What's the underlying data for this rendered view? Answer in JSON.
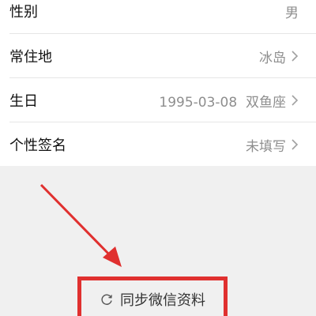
{
  "profile": {
    "rows": [
      {
        "label": "性别",
        "value": "男",
        "has_chevron": false
      },
      {
        "label": "常住地",
        "value": "冰岛",
        "has_chevron": true
      },
      {
        "label": "生日",
        "value": "1995-03-08  双鱼座",
        "has_chevron": true
      },
      {
        "label": "个性签名",
        "value": "未填写",
        "has_chevron": true
      }
    ]
  },
  "sync": {
    "label": "同步微信资料"
  },
  "colors": {
    "annotation_red": "#e0302f",
    "secondary_text": "#8e8e8e",
    "gray_bg": "#f0f0f0"
  }
}
